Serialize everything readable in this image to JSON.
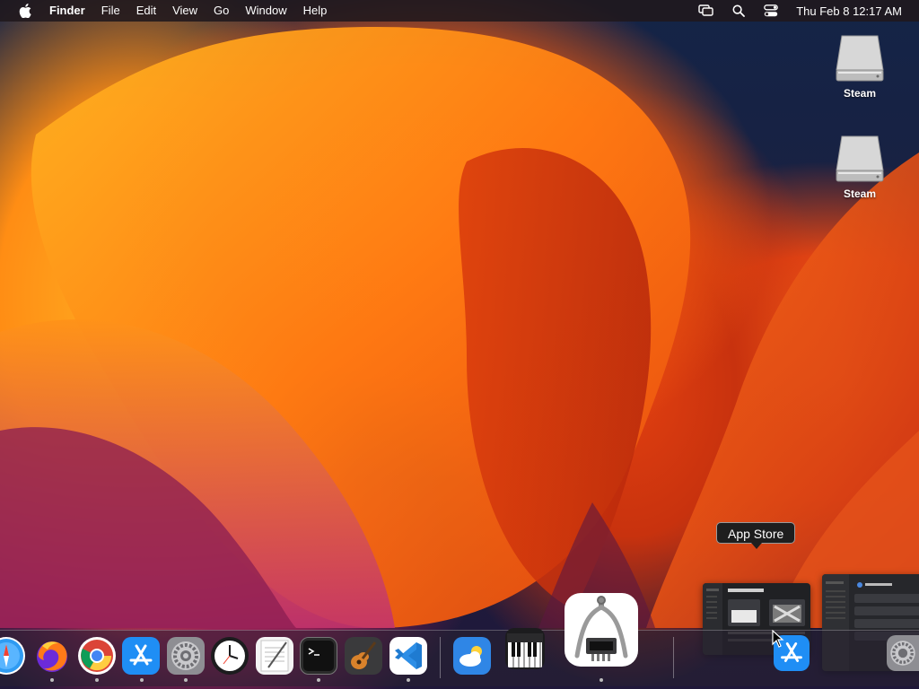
{
  "menubar": {
    "apple": "apple-logo",
    "app_name": "Finder",
    "items": [
      "File",
      "Edit",
      "View",
      "Go",
      "Window",
      "Help"
    ],
    "status_icons": [
      "screen-mirroring-icon",
      "search-icon",
      "control-center-icon"
    ],
    "clock": "Thu Feb 8  12:17 AM"
  },
  "desktop": {
    "icons": [
      {
        "label": "Steam",
        "icon": "external-drive-icon"
      },
      {
        "label": "Steam",
        "icon": "external-drive-icon"
      }
    ]
  },
  "tooltip": {
    "text": "App Store"
  },
  "dock": {
    "apps": [
      "Safari",
      "Firefox",
      "Google Chrome",
      "App Store",
      "System Settings",
      "Clock",
      "TextEdit",
      "Terminal",
      "GarageBand",
      "Visual Studio Code",
      "Weather",
      "Piano",
      "System Information",
      "App Store",
      "System Settings"
    ]
  },
  "colors": {
    "menubar": "#201a1e",
    "tooltip_bg": "#1e1e1e",
    "appstore_blue": "#1f8ef5",
    "vscode_blue": "#1f7bd1"
  }
}
